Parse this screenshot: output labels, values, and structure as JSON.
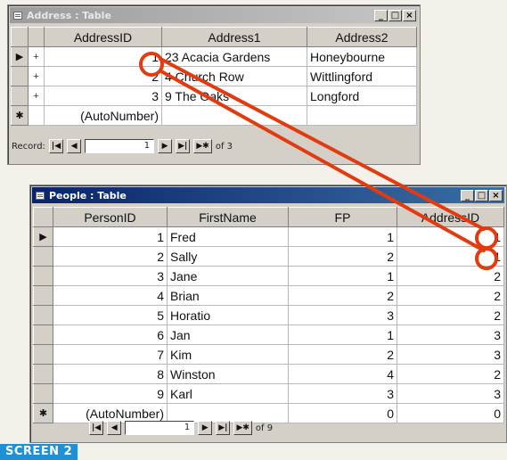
{
  "address_window": {
    "title": "Address : Table",
    "columns": [
      "AddressID",
      "Address1",
      "Address2"
    ],
    "rows": [
      {
        "selector": "▶",
        "expander": "+",
        "id": "1",
        "address1": "23 Acacia Gardens",
        "address2": "Honeybourne"
      },
      {
        "selector": "",
        "expander": "+",
        "id": "2",
        "address1": "4 Church Row",
        "address2": "Wittlingford"
      },
      {
        "selector": "",
        "expander": "+",
        "id": "3",
        "address1": "9 The Oaks",
        "address2": "Longford"
      }
    ],
    "new_row": {
      "selector": "✱",
      "id": "(AutoNumber)"
    },
    "record_label": "Record:",
    "record_value": "1",
    "record_total": "of 3"
  },
  "people_window": {
    "title": "People : Table",
    "columns": [
      "PersonID",
      "FirstName",
      "FP",
      "AddressID"
    ],
    "rows": [
      {
        "selector": "▶",
        "id": "1",
        "name": "Fred",
        "fp": "1",
        "address_id": "1"
      },
      {
        "selector": "",
        "id": "2",
        "name": "Sally",
        "fp": "2",
        "address_id": "1"
      },
      {
        "selector": "",
        "id": "3",
        "name": "Jane",
        "fp": "1",
        "address_id": "2"
      },
      {
        "selector": "",
        "id": "4",
        "name": "Brian",
        "fp": "2",
        "address_id": "2"
      },
      {
        "selector": "",
        "id": "5",
        "name": "Horatio",
        "fp": "3",
        "address_id": "2"
      },
      {
        "selector": "",
        "id": "6",
        "name": "Jan",
        "fp": "1",
        "address_id": "3"
      },
      {
        "selector": "",
        "id": "7",
        "name": "Kim",
        "fp": "2",
        "address_id": "3"
      },
      {
        "selector": "",
        "id": "8",
        "name": "Winston",
        "fp": "4",
        "address_id": "2"
      },
      {
        "selector": "",
        "id": "9",
        "name": "Karl",
        "fp": "3",
        "address_id": "3"
      }
    ],
    "new_row": {
      "selector": "✱",
      "id": "(AutoNumber)",
      "fp": "0",
      "address_id": "0"
    },
    "record_value": "1",
    "record_total": "of 9"
  },
  "window_buttons": {
    "minimize": "_",
    "maximize": "□",
    "close": "×"
  },
  "nav_buttons": {
    "first": "|◀",
    "prev": "◀",
    "next": "▶",
    "last": "▶|",
    "new": "▶✱"
  },
  "caption": "SCREEN 2",
  "colors": {
    "annotation": "#e23b10",
    "caption_bg": "#1f8fd6"
  }
}
